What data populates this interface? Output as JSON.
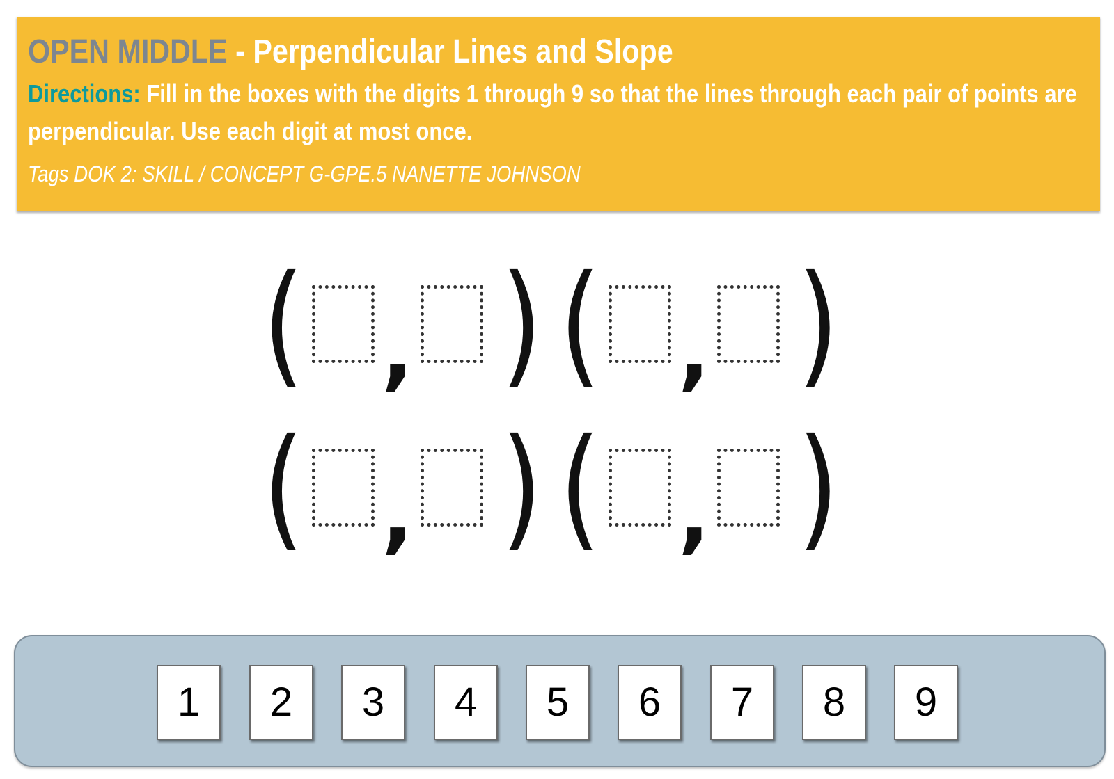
{
  "header": {
    "brand": "OPEN MIDDLE",
    "separator": " - ",
    "title": "Perpendicular Lines and Slope",
    "directions_label": "Directions:",
    "directions_text": " Fill in the boxes with the digits 1 through 9 so that the lines through each pair of points are perpendicular. Use each digit at most once.",
    "tags": "Tags  DOK 2: SKILL / CONCEPT G-GPE.5 NANETTE JOHNSON"
  },
  "puzzle": {
    "open_paren": "(",
    "close_paren": ")",
    "comma": ","
  },
  "tray": {
    "digits": [
      "1",
      "2",
      "3",
      "4",
      "5",
      "6",
      "7",
      "8",
      "9"
    ]
  },
  "colors": {
    "banner": "#F6BC33",
    "brand": "#7D8690",
    "directions_label": "#0E9A9C",
    "tray": "#B3C6D3"
  }
}
